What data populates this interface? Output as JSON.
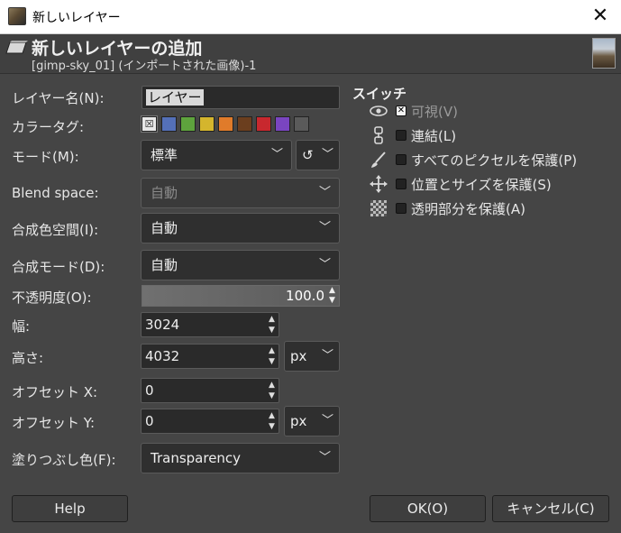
{
  "window": {
    "title": "新しいレイヤー",
    "close": "✕"
  },
  "header": {
    "title": "新しいレイヤーの追加",
    "subtitle": "[gimp-sky_01] (インポートされた画像)-1"
  },
  "form": {
    "layer_name": {
      "label": "レイヤー名(N):",
      "value": "レイヤー"
    },
    "color_tag": {
      "label": "カラータグ:",
      "tags": [
        "#e8e8e8",
        "#5470b8",
        "#5ea33d",
        "#d4b52d",
        "#e07b2a",
        "#6b3e1e",
        "#c8282e",
        "#7a45c0",
        "#5a5a5a"
      ],
      "none_glyph": "☒"
    },
    "mode": {
      "label": "モード(M):",
      "value": "標準",
      "reset_glyph": "↺"
    },
    "blend_space": {
      "label": "Blend space:",
      "value": "自動"
    },
    "composite_space": {
      "label": "合成色空間(I):",
      "value": "自動"
    },
    "composite_mode": {
      "label": "合成モード(D):",
      "value": "自動"
    },
    "opacity": {
      "label": "不透明度(O):",
      "value": "100.0"
    },
    "width": {
      "label": "幅:",
      "value": "3024"
    },
    "height": {
      "label": "高さ:",
      "value": "4032",
      "unit": "px"
    },
    "offset_x": {
      "label": "オフセット X:",
      "value": "0"
    },
    "offset_y": {
      "label": "オフセット Y:",
      "value": "0",
      "unit": "px"
    },
    "fill": {
      "label": "塗りつぶし色(F):",
      "value": "Transparency"
    }
  },
  "switches": {
    "title": "スイッチ",
    "visible": {
      "label": "可視(V)",
      "checked": true
    },
    "linked": {
      "label": "連結(L)",
      "checked": false
    },
    "lock_pixels": {
      "label": "すべてのピクセルを保護(P)",
      "checked": false
    },
    "lock_position": {
      "label": "位置とサイズを保護(S)",
      "checked": false
    },
    "lock_alpha": {
      "label": "透明部分を保護(A)",
      "checked": false
    }
  },
  "buttons": {
    "help": "Help",
    "ok": "OK(O)",
    "cancel": "キャンセル(C)"
  },
  "glyphs": {
    "chevron": "﹀",
    "up": "▲",
    "down": "▼",
    "check": "✕",
    "eye": "👁",
    "chain": "⛓",
    "brush": "🖌",
    "move": "✥"
  }
}
